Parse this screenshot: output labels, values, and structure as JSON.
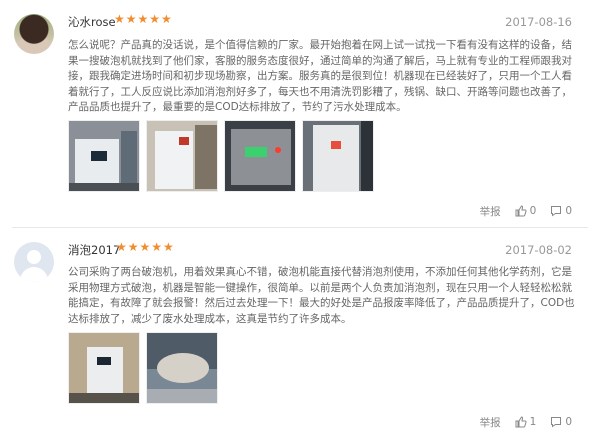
{
  "reviews": [
    {
      "username": "沁水rose",
      "stars": "★★★★★",
      "rating": 5,
      "date": "2017-08-16",
      "content": "怎么说呢？产品真的没话说，是个值得信赖的厂家。最开始抱着在网上试一试找一下看有没有这样的设备，结果一搜破泡机就找到了他们家，客服的服务态度很好，通过简单的沟通了解后，马上就有专业的工程师跟我对接，跟我确定进场时间和初步现场勘察，出方案。服务真的是很到位！机器现在已经装好了，只用一个工人看着就行了，工人反应说比添加消泡剂好多了，每天也不用清洗罚影糟了，残锅、缺口、开路等问题也改善了，产品品质也提升了，最重要的是COD达标排放了，节约了污水处理成本。",
      "actions": {
        "report": "举报",
        "likes": "0",
        "comments": "0"
      }
    },
    {
      "username": "消泡2017",
      "stars": "★★★★★",
      "rating": 5,
      "date": "2017-08-02",
      "content": "公司采购了两台破泡机，用着效果真心不错，破泡机能直接代替消泡剂使用，不添加任何其他化学药剂，它是采用物理方式破泡，机器是智能一键操作，很简单。以前是两个人负责加消泡剂，现在只用一个人轻轻松松就能搞定，有故障了就会报警！然后过去处理一下！最大的好处是产品报废率降低了，产品品质提升了，COD也达标排放了，减少了废水处理成本，这真是节约了许多成本。",
      "actions": {
        "report": "举报",
        "likes": "1",
        "comments": "0"
      }
    }
  ],
  "icons": {
    "like": "thumbs-up-icon",
    "comment": "comment-bubble-icon"
  },
  "colors": {
    "stars": "#f08d2e",
    "text": "#666666",
    "date": "#999999"
  }
}
